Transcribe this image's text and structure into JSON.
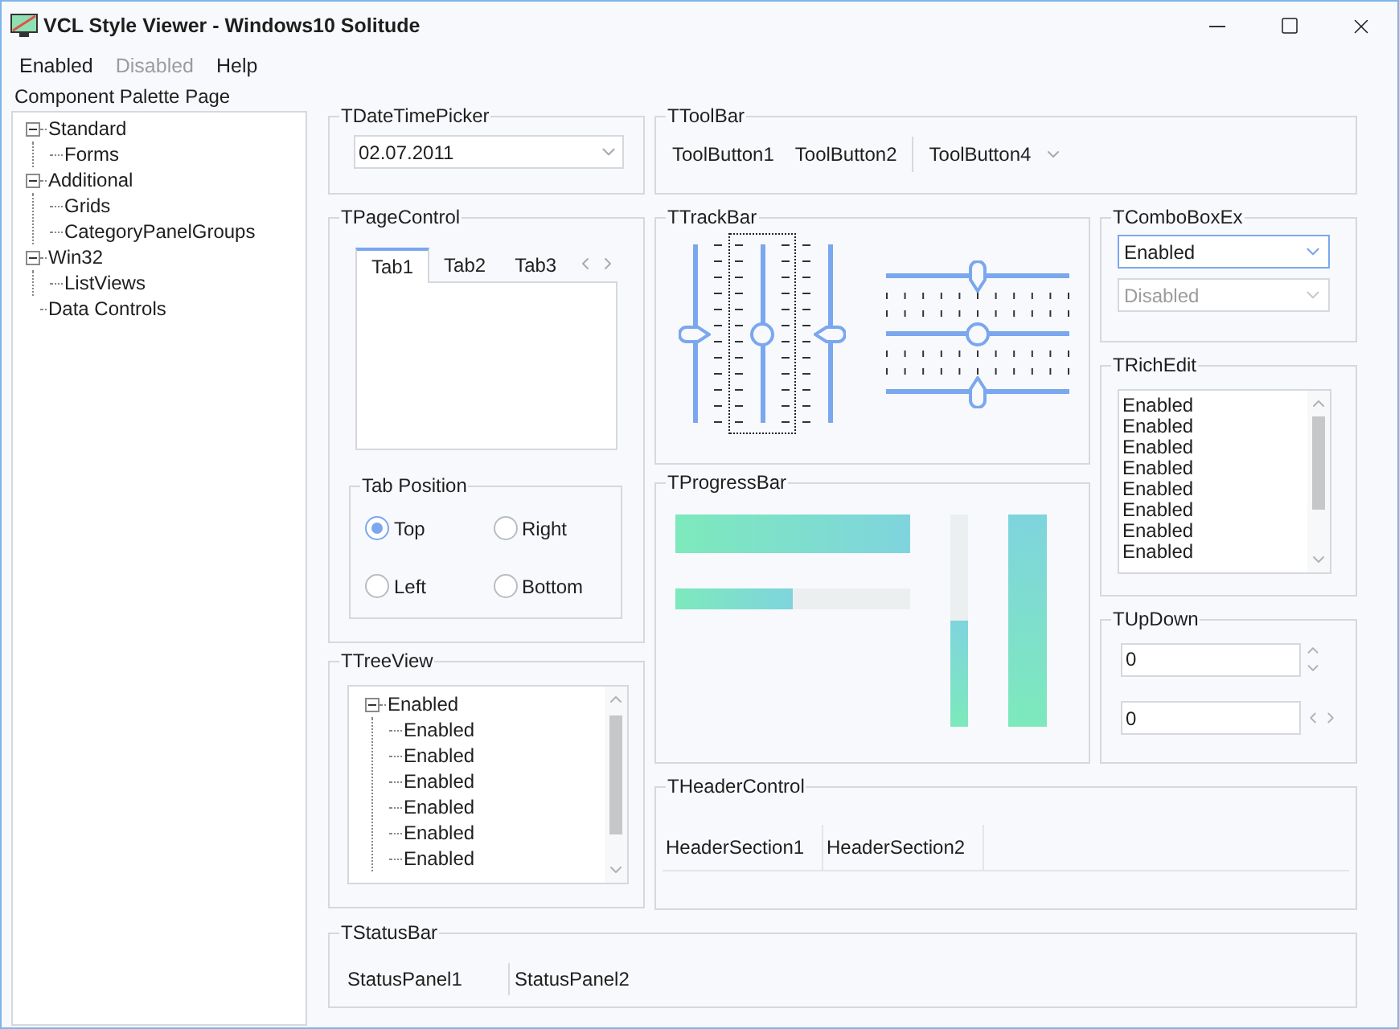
{
  "window": {
    "title": "VCL Style Viewer - Windows10 Solitude"
  },
  "menu": [
    {
      "label": "Enabled",
      "disabled": false
    },
    {
      "label": "Disabled",
      "disabled": true
    },
    {
      "label": "Help",
      "disabled": false
    }
  ],
  "palette": {
    "label": "Component Palette Page",
    "tree": [
      {
        "label": "Standard",
        "expanded": true,
        "children": [
          {
            "label": "Forms"
          }
        ]
      },
      {
        "label": "Additional",
        "expanded": true,
        "children": [
          {
            "label": "Grids"
          },
          {
            "label": "CategoryPanelGroups"
          }
        ]
      },
      {
        "label": "Win32",
        "expanded": true,
        "children": [
          {
            "label": "ListViews"
          }
        ]
      },
      {
        "label": "Data Controls"
      }
    ]
  },
  "date_time_picker": {
    "title": "TDateTimePicker",
    "value": "02.07.2011"
  },
  "toolbar": {
    "title": "TToolBar",
    "items": [
      {
        "kind": "button",
        "label": "ToolButton1"
      },
      {
        "kind": "button",
        "label": "ToolButton2"
      },
      {
        "kind": "separator"
      },
      {
        "kind": "dropdown",
        "label": "ToolButton4"
      }
    ]
  },
  "page_control": {
    "title": "TPageControl",
    "tabs": [
      {
        "label": "Tab1",
        "selected": true
      },
      {
        "label": "Tab2",
        "selected": false
      },
      {
        "label": "Tab3",
        "selected": false
      }
    ],
    "tab_position": {
      "title": "Tab Position",
      "options": [
        {
          "label": "Top",
          "selected": true
        },
        {
          "label": "Right",
          "selected": false
        },
        {
          "label": "Left",
          "selected": false
        },
        {
          "label": "Bottom",
          "selected": false
        }
      ]
    }
  },
  "track_bar": {
    "title": "TTrackBar",
    "vertical": [
      {
        "kind": "after",
        "level": 0.5,
        "focused": false
      },
      {
        "kind": "both",
        "level": 0.5,
        "focused": true
      },
      {
        "kind": "before",
        "level": 0.5,
        "focused": false
      }
    ],
    "horizontal": [
      {
        "kind": "after",
        "level": 0.5
      },
      {
        "kind": "both",
        "level": 0.5
      },
      {
        "kind": "before",
        "level": 0.5
      }
    ]
  },
  "progress_bar": {
    "title": "TProgressBar",
    "bars": [
      {
        "kind": "wide",
        "level": 1
      },
      {
        "kind": "narrow",
        "level": 0.5
      },
      {
        "kind": "slim",
        "level": 0.5
      },
      {
        "kind": "tall",
        "level": 1
      }
    ]
  },
  "combo_box_ex": {
    "title": "TComboBoxEx",
    "combos": [
      {
        "value": "Enabled",
        "disabled": false,
        "focused": true
      },
      {
        "value": "Disabled",
        "disabled": true,
        "focused": false
      }
    ]
  },
  "rich_edit": {
    "title": "TRichEdit",
    "lines": [
      "Enabled",
      "Enabled",
      "Enabled",
      "Enabled",
      "Enabled",
      "Enabled",
      "Enabled",
      "Enabled"
    ]
  },
  "up_down": {
    "title": "TUpDown",
    "fields": [
      {
        "value": "0",
        "kind": "vertical"
      },
      {
        "value": "0",
        "kind": "horizontal"
      }
    ]
  },
  "tree_view": {
    "title": "TTreeView",
    "nodes": [
      {
        "label": "Enabled",
        "expanded": true,
        "children": [
          {
            "label": "Enabled"
          },
          {
            "label": "Enabled"
          },
          {
            "label": "Enabled"
          },
          {
            "label": "Enabled"
          },
          {
            "label": "Enabled"
          },
          {
            "label": "Enabled"
          }
        ]
      }
    ]
  },
  "header_control": {
    "title": "THeaderControl",
    "sections": [
      "HeaderSection1",
      "HeaderSection2"
    ]
  },
  "status_bar": {
    "title": "TStatusBar",
    "panels": [
      "StatusPanel1",
      "StatusPanel2"
    ]
  }
}
